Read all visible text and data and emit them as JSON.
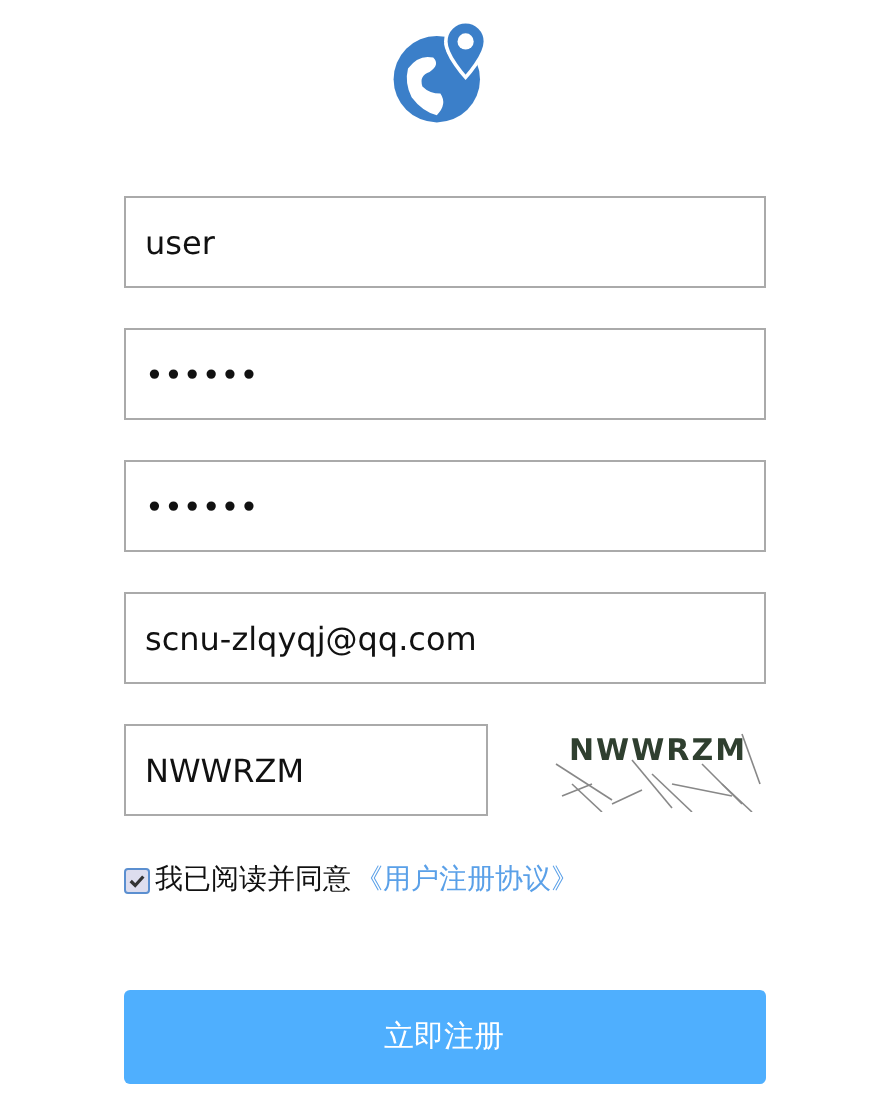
{
  "fields": [
    {
      "kind": "text",
      "value": "user"
    },
    {
      "kind": "text",
      "value": "••••••"
    },
    {
      "kind": "text",
      "value": "••••••"
    },
    {
      "kind": "text",
      "value": "scnu-zlqyqj@qq.com"
    }
  ],
  "captcha": {
    "value": "NWWRZM",
    "image_text": "NWWRZM"
  },
  "agreement": {
    "checked": true,
    "text": "我已阅读并同意",
    "link": "《用户注册协议》"
  },
  "submit": "立即注册"
}
